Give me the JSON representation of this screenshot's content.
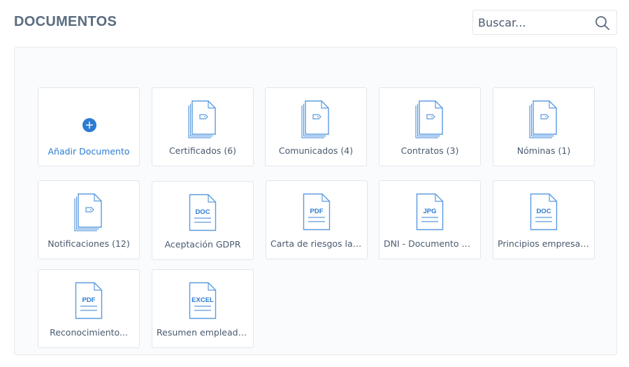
{
  "header": {
    "title": "DOCUMENTOS",
    "search_placeholder": "Buscar..."
  },
  "colors": {
    "accent": "#2b7bd3",
    "title": "#5a6b80",
    "text": "#4a5a6e",
    "border": "#e2e6eb"
  },
  "add_document": {
    "label": "Añadir Documento",
    "icon": "plus-icon"
  },
  "folders": [
    {
      "label": "Certificados (6)",
      "icon": "folder-stack-icon"
    },
    {
      "label": "Comunicados (4)",
      "icon": "folder-stack-icon"
    },
    {
      "label": "Contratos (3)",
      "icon": "folder-stack-icon"
    },
    {
      "label": "Nóminas (1)",
      "icon": "folder-stack-icon"
    },
    {
      "label": "Notificaciones (12)",
      "icon": "folder-stack-icon"
    }
  ],
  "files": [
    {
      "label": "Aceptación GDPR",
      "type": "DOC"
    },
    {
      "label": "Carta de riesgos labo...",
      "type": "PDF"
    },
    {
      "label": "DNI - Documento Na...",
      "type": "JPG"
    },
    {
      "label": "Principios empresaria...",
      "type": "DOC"
    },
    {
      "label": "Reconocimiento...",
      "type": "PDF"
    },
    {
      "label": "Resumen empleados...",
      "type": "EXCEL"
    }
  ]
}
